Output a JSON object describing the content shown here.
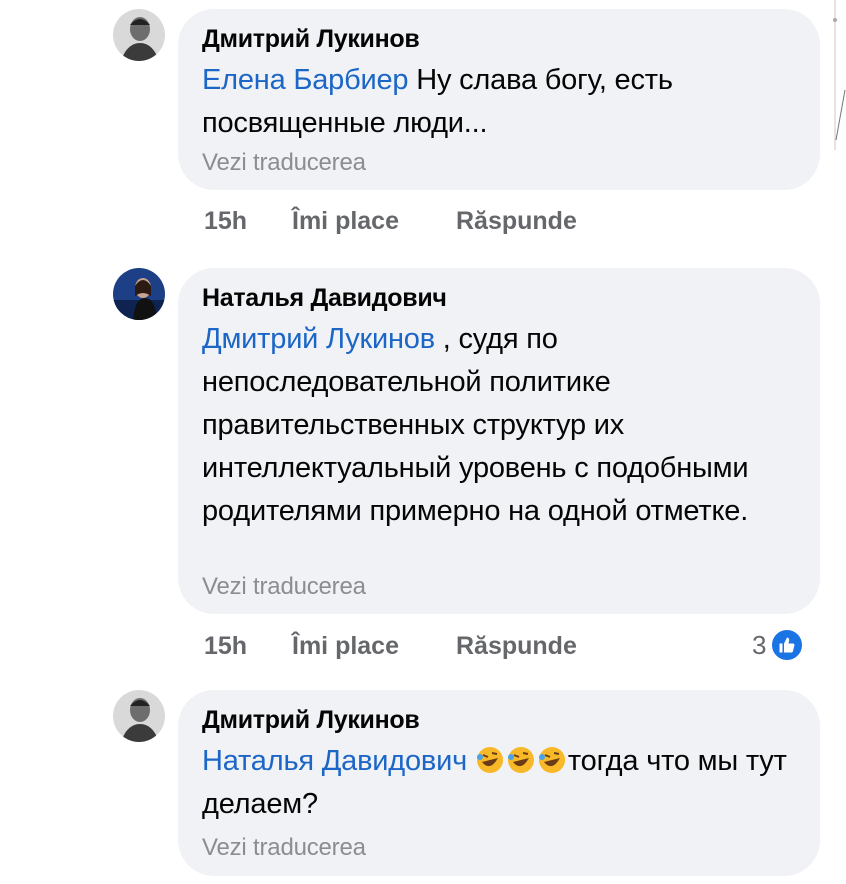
{
  "comments": [
    {
      "author": "Дмитрий Лукинов",
      "mention": "Елена Барбиер",
      "text": "Ну слава богу, есть посвященные люди...",
      "translate": "Vezi traducerea",
      "time": "15h",
      "like": "Îmi place",
      "reply": "Răspunde"
    },
    {
      "author": "Наталья Давидович",
      "mention": "Дмитрий Лукинов",
      "text": ", судя по непоследовательной политике правительственных структур их интеллектуальный уровень с подобными родителями примерно на одной отметке.",
      "translate": "Vezi traducerea",
      "time": "15h",
      "like": "Îmi place",
      "reply": "Răspunde",
      "reaction_count": "3"
    },
    {
      "author": "Дмитрий Лукинов",
      "mention": "Наталья Давидович",
      "text": "тогда что мы тут делаем?",
      "translate": "Vezi traducerea",
      "emoji": [
        "rolling-laughing-icon",
        "rolling-laughing-icon",
        "rolling-laughing-icon"
      ]
    }
  ],
  "colors": {
    "bubble": "#f0f2f5",
    "mention": "#1b66c6",
    "meta": "#65676b",
    "like": "#1b74e4"
  }
}
